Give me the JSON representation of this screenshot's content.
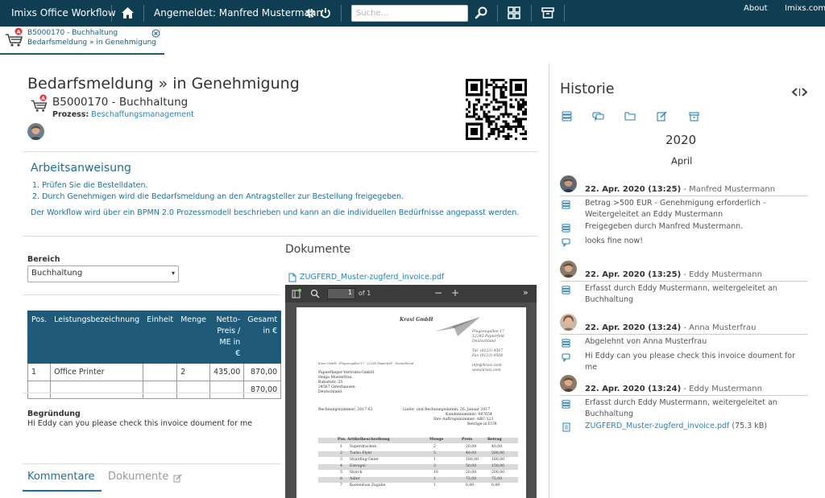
{
  "topbar": {
    "app_title": "Imixs Office Workflow",
    "user_label": "Angemeldet: Manfred Mustermann",
    "search_placeholder": "Suche...",
    "about": "About",
    "site": "Imixs.com"
  },
  "worklist_tab": {
    "title": "B5000170 - Buchhaltung",
    "subtitle": "Bedarfsmeldung » in Genehmigung"
  },
  "header": {
    "title": "Bedarfsmeldung » in Genehmigung",
    "subtitle": "B5000170 - Buchhaltung",
    "process_label": "Prozess:",
    "process_value": "Beschaffungsmanagement"
  },
  "arbeitsanweisung": {
    "title": "Arbeitsanweisung",
    "steps": [
      "1. Prüfen Sie die Bestelldaten.",
      "2. Durch Genehmigen wird die Bedarfsmeldung an den Antragsteller zur Bestellung freigegeben."
    ],
    "note": "Der Workflow wird über ein BPMN 2.0 Prozessmodell beschrieben und kann an die individuellen Bedürfnisse angepasst werden."
  },
  "form": {
    "bereich_label": "Bereich",
    "bereich_value": "Buchhaltung",
    "table": {
      "headers": [
        "Pos.",
        "Leistungsbezeichnung",
        "Einheit",
        "Menge",
        "Netto-Preis / ME in €",
        "Gesamt in €"
      ],
      "header_lines": {
        "netto": [
          "Netto-",
          "Preis /",
          "ME in €"
        ],
        "gesamt": [
          "Gesamt",
          "in €"
        ]
      },
      "rows": [
        {
          "pos": "1",
          "bezeichnung": "Office Printer",
          "einheit": "",
          "menge": "2",
          "netto": "435,00",
          "gesamt": "870,00"
        }
      ],
      "total": "870,00"
    },
    "begruendung_label": "Begründung",
    "begruendung_text": "Hi Eddy can you please check this invoice doument for me"
  },
  "bottom_tabs": {
    "kommentare": "Kommentare",
    "dokumente": "Dokumente"
  },
  "documents": {
    "title": "Dokumente",
    "file": "ZUGFERD_Muster-zugferd_invoice.pdf",
    "viewer": {
      "page": "1",
      "of": "of 1"
    },
    "invoice": {
      "company": "Kraxi GmbH",
      "sender_address": [
        "Flugzeugallee 17",
        "12345 Papierfeld",
        "Deutschland"
      ],
      "sender_contact": [
        "Tel. (0123) 4567",
        "Fax (0123) 4568",
        "",
        "info@kraxi.com",
        "www.kraxi.com"
      ],
      "sender_line": "Kraxi GmbH · Flugzeugallee 17 · 12345 Papierfeld · Deutschland",
      "recipient": [
        "Papierflieger-Vertriebs-GmbH",
        "Helga Musterfrau",
        "Rabattstr. 25",
        "34567 Osterhausen",
        "Deutschland"
      ],
      "invoice_no": "Rechnungsnummer: 2017-03",
      "dates": [
        "Liefer- und Rechnungsdatum: 26. Januar 2017",
        "Kundennummer: 987654",
        "Ihre Auftragsnummer: ABC-123",
        "Beträge in EUR"
      ],
      "columns": [
        "Pos.",
        "Artikelbeschreibung",
        "Menge",
        "Preis",
        "Betrag"
      ],
      "items": [
        [
          "1",
          "Superdrachen",
          "2",
          "20,00",
          "40,00"
        ],
        [
          "2",
          "Turbo Flyer",
          "5",
          "40,00",
          "200,00"
        ],
        [
          "3",
          "Sturzflug-Geier",
          "1",
          "180,00",
          "180,00"
        ],
        [
          "4",
          "Eisvogel",
          "3",
          "50,00",
          "150,00"
        ],
        [
          "5",
          "Storch",
          "10",
          "20,00",
          "200,00"
        ],
        [
          "6",
          "Adler",
          "1",
          "75,00",
          "75,00"
        ],
        [
          "7",
          "Kostenlose Zugabe",
          "1",
          "0,00",
          "0,00"
        ]
      ]
    }
  },
  "history": {
    "title": "Historie",
    "year": "2020",
    "month": "April",
    "entries": [
      {
        "date": "22. Apr. 2020 (13:25)",
        "who": " - Manfred Mustermann",
        "items": [
          {
            "icon": "list-icon",
            "text": "Betrag >500 EUR - Genehmigung erforderlich - Weitergeleitet an Eddy Mustermann"
          },
          {
            "icon": "list-icon",
            "text": "Freigegeben durch Manfred Mustermann."
          },
          {
            "icon": "comment-icon",
            "text": "looks fine now!"
          }
        ]
      },
      {
        "date": "22. Apr. 2020 (13:25)",
        "who": " - Eddy Mustermann",
        "items": [
          {
            "icon": "list-icon",
            "text": "Erfasst durch Eddy Mustermann, weitergeleitet an Buchhaltung"
          }
        ]
      },
      {
        "date": "22. Apr. 2020 (13:24)",
        "who": " - Anna Musterfrau",
        "items": [
          {
            "icon": "list-icon",
            "text": "Abgelehnt von Anna Musterfrau"
          },
          {
            "icon": "comment-icon",
            "text": "Hi Eddy can you please check this invoice doument for me"
          }
        ]
      },
      {
        "date": "22. Apr. 2020 (13:24)",
        "who": " - Eddy Mustermann",
        "items": [
          {
            "icon": "list-icon",
            "text": "Erfasst durch Eddy Mustermann, weitergeleitet an Buchhaltung"
          },
          {
            "icon": "file-icon",
            "link": "ZUGFERD_Muster-zugferd_invoice.pdf",
            "text": " (75.3 kB)"
          }
        ]
      }
    ]
  },
  "colors": {
    "topbar": "#0f3d52",
    "accent": "#1f5b78",
    "link": "#2b82b5",
    "instruction": "#1f6f9a"
  }
}
